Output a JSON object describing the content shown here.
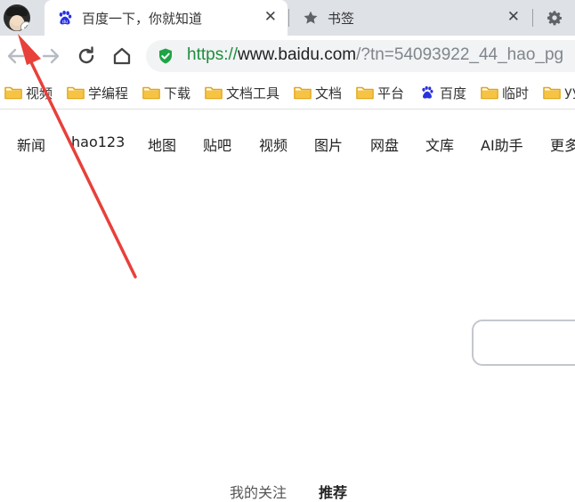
{
  "tabs": [
    {
      "title": "百度一下，你就知道",
      "icon": "baidu-paw-icon",
      "active": true
    },
    {
      "title": "书签",
      "icon": "star-icon",
      "active": false
    },
    {
      "title": "",
      "icon": "gear-icon",
      "active": false
    }
  ],
  "tab_close_glyph": "✕",
  "toolbar": {
    "back_icon": "back-arrow-icon",
    "forward_icon": "forward-arrow-icon",
    "reload_icon": "reload-icon",
    "home_icon": "home-icon",
    "url_scheme": "https://",
    "url_host": "www.baidu.com",
    "url_rest": "/?tn=54093922_44_hao_pg"
  },
  "bookmarks": [
    {
      "label": "视频",
      "icon": "folder-icon"
    },
    {
      "label": "学编程",
      "icon": "folder-icon"
    },
    {
      "label": "下载",
      "icon": "folder-icon"
    },
    {
      "label": "文档工具",
      "icon": "folder-icon"
    },
    {
      "label": "文档",
      "icon": "folder-icon"
    },
    {
      "label": "平台",
      "icon": "folder-icon"
    },
    {
      "label": "百度",
      "icon": "baidu-paw-icon"
    },
    {
      "label": "临时",
      "icon": "folder-icon"
    },
    {
      "label": "yy",
      "icon": "folder-icon"
    }
  ],
  "page_nav": [
    "新闻",
    "hao123",
    "地图",
    "贴吧",
    "视频",
    "图片",
    "网盘",
    "文库",
    "AI助手",
    "更多"
  ],
  "feed_tabs": {
    "follow": "我的关注",
    "recommend": "推荐"
  },
  "colors": {
    "accent_red": "#e8403a",
    "secure_green": "#1e8e3e",
    "folder_yellow": "#f6c343",
    "baidu_blue": "#2932e1"
  }
}
